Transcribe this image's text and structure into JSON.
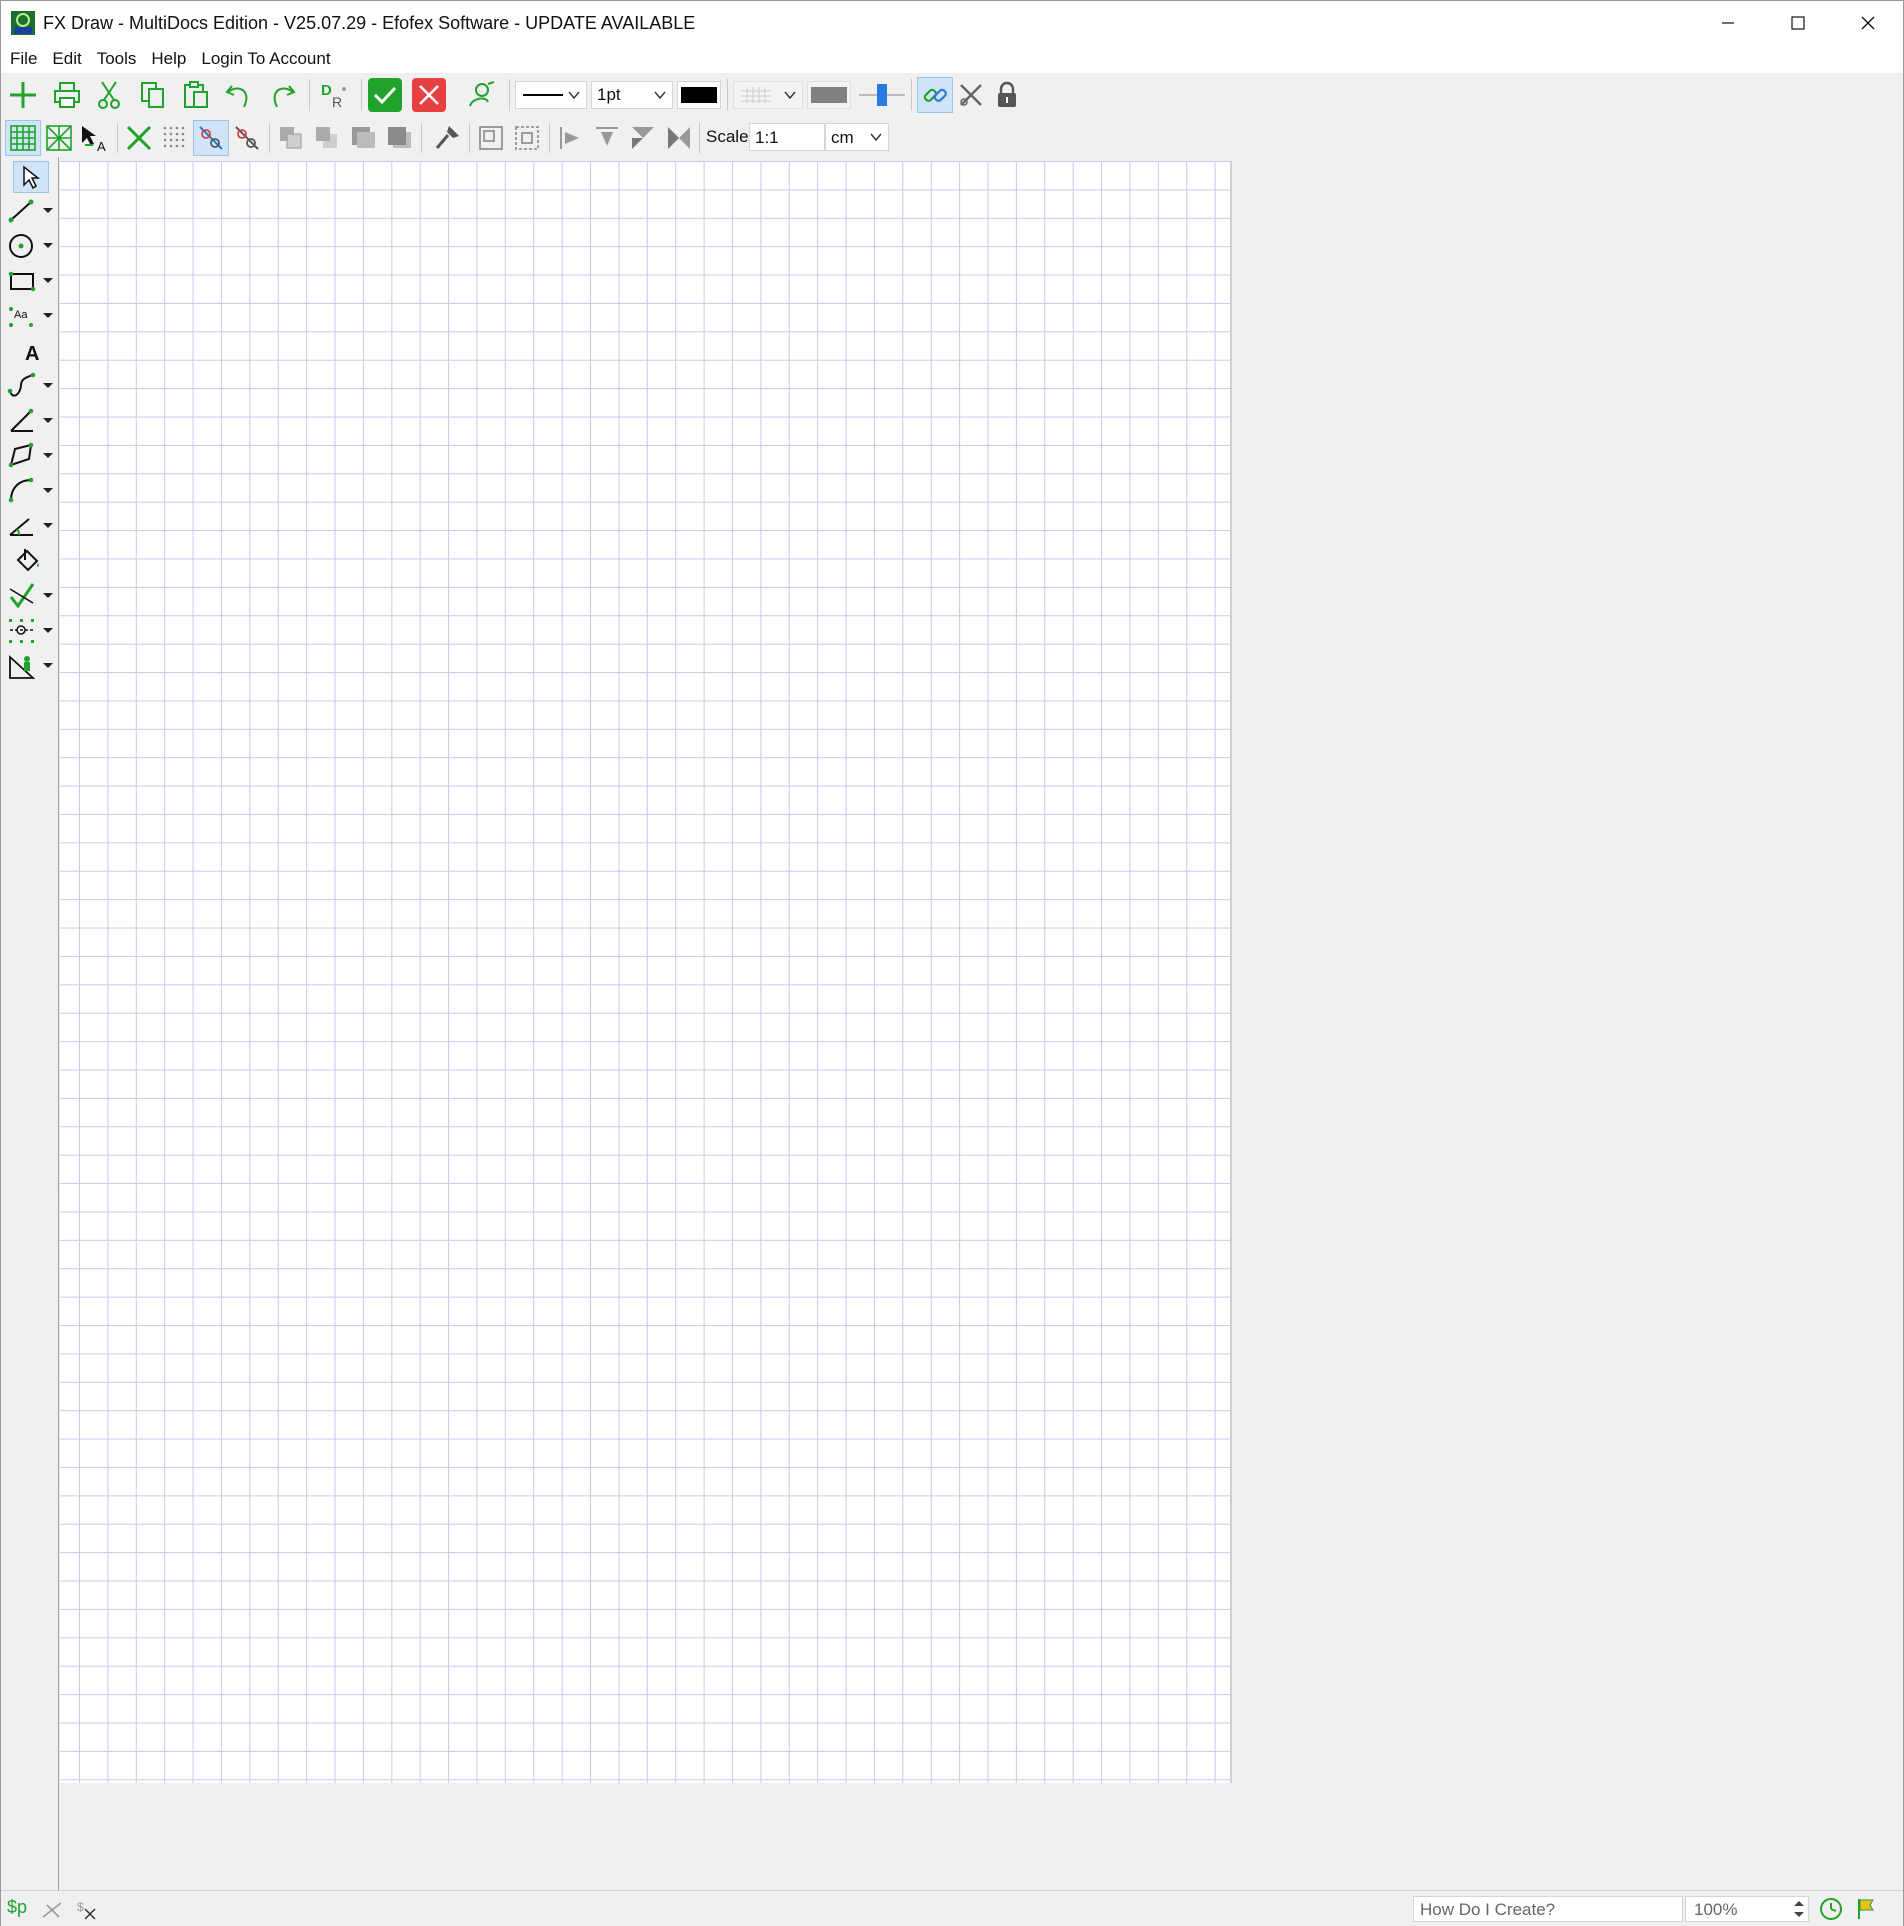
{
  "window": {
    "title": "FX Draw - MultiDocs Edition - V25.07.29 - Efofex Software - UPDATE AVAILABLE",
    "app_icon_text": "FXD"
  },
  "menu": {
    "file": "File",
    "edit": "Edit",
    "tools": "Tools",
    "help": "Help",
    "login": "Login To Account"
  },
  "toolbar": {
    "line_width": "1pt",
    "line_color": "#000000",
    "fill_color": "#808080",
    "accent_green": "#1fa32a",
    "accent_red": "#e84040",
    "scale_label": "Scale",
    "scale_value": "1:1",
    "units": "cm"
  },
  "tools": [
    "select-tool",
    "line-tool",
    "circle-tool",
    "rectangle-tool",
    "label-points-tool",
    "text-tool",
    "curve-tool",
    "angle-line-tool",
    "polygon-tool",
    "arc-tool",
    "angle-tool",
    "fill-tool",
    "vector-tool",
    "dimension-tool",
    "figure-tool"
  ],
  "status": {
    "dollar_p": "$p",
    "how_do_i_create": "How Do I Create?",
    "zoom": "100%"
  },
  "page": {
    "grid_color": "#c9c9ea"
  }
}
